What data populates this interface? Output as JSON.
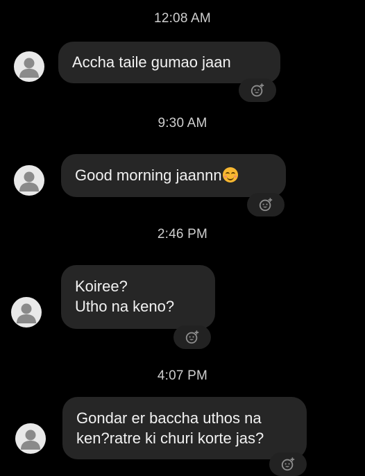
{
  "messages": [
    {
      "timestamp": "12:08 AM",
      "lines": [
        "Accha taile gumao jaan"
      ]
    },
    {
      "timestamp": "9:30 AM",
      "lines": [
        "Good morning jaannn"
      ],
      "emoji": "smiling-face-with-closed-eyes"
    },
    {
      "timestamp": "2:46 PM",
      "lines": [
        "Koiree?",
        "Utho na keno?"
      ]
    },
    {
      "timestamp": "4:07 PM",
      "lines": [
        "Gondar er baccha uthos na",
        "ken?ratre ki churi korte jas?"
      ]
    }
  ],
  "icons": {
    "avatar": "default-profile-avatar-icon",
    "reaction": "add-reaction-icon"
  },
  "colors": {
    "background": "#000000",
    "bubble": "#262626",
    "text": "#f2f2f2",
    "timestamp": "#cfcfcf",
    "avatar": "#e9e9e9"
  }
}
